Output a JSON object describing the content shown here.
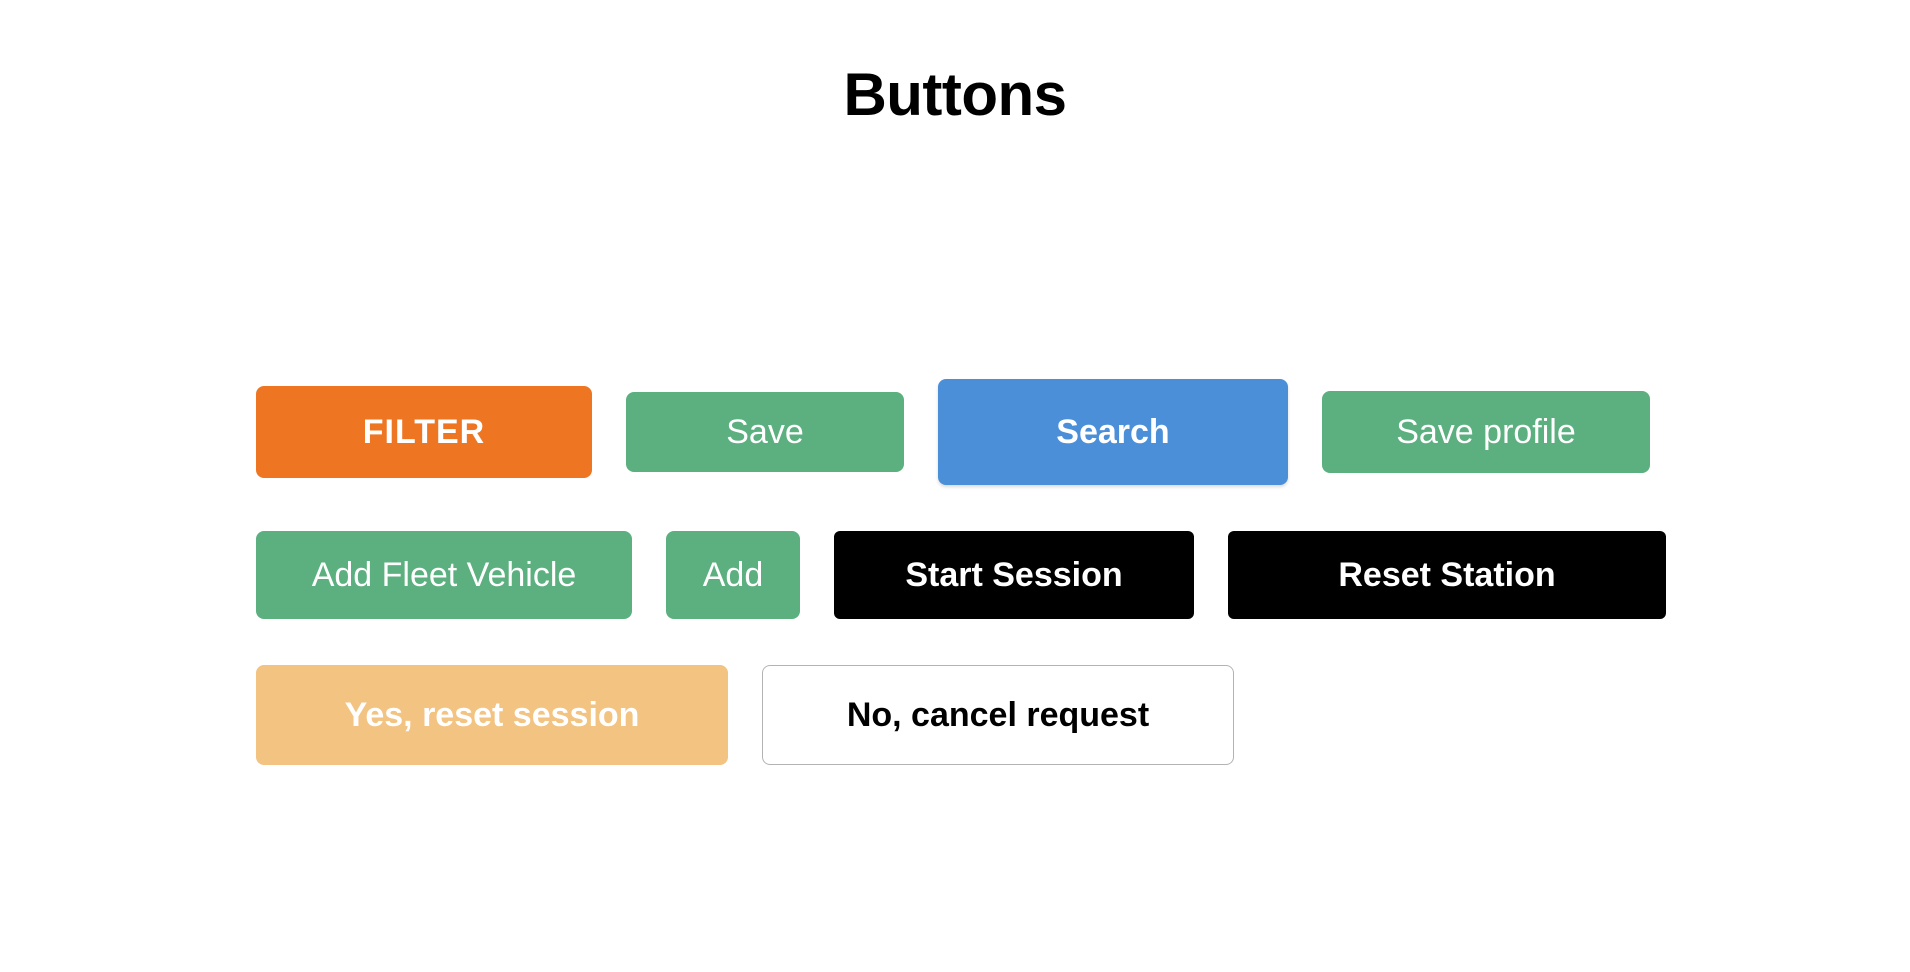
{
  "title": "Buttons",
  "buttons": {
    "filter": "FILTER",
    "save": "Save",
    "search": "Search",
    "save_profile": "Save profile",
    "add_fleet_vehicle": "Add Fleet Vehicle",
    "add": "Add",
    "start_session": "Start Session",
    "reset_station": "Reset Station",
    "yes_reset_session": "Yes, reset session",
    "no_cancel_request": "No, cancel request"
  },
  "colors": {
    "orange": "#ee7623",
    "green": "#5cb07f",
    "blue": "#4b8fd9",
    "black": "#000000",
    "light_orange": "#f2c381",
    "white": "#ffffff"
  }
}
